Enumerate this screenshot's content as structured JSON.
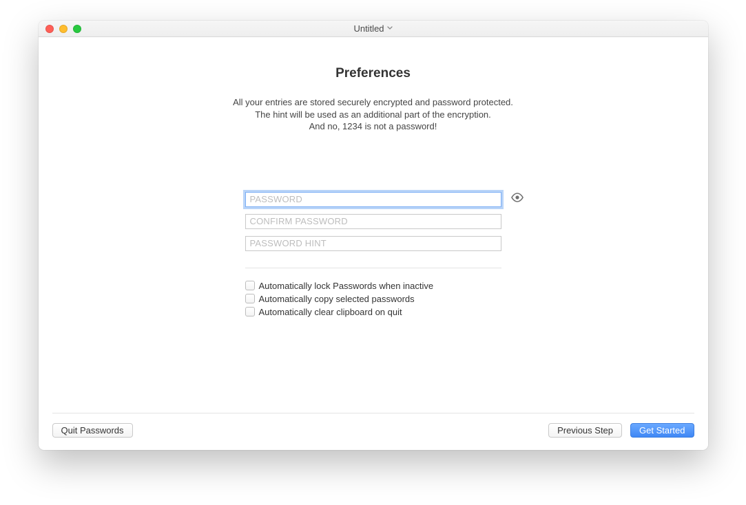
{
  "window": {
    "title": "Untitled"
  },
  "header": {
    "heading": "Preferences",
    "desc_line1": "All your entries are stored securely encrypted and password protected.",
    "desc_line2": "The hint will be used as an additional part of the encryption.",
    "desc_line3": "And no, 1234 is not a password!"
  },
  "form": {
    "password_placeholder": "PASSWORD",
    "confirm_placeholder": "CONFIRM PASSWORD",
    "hint_placeholder": "PASSWORD HINT",
    "password_value": "",
    "confirm_value": "",
    "hint_value": ""
  },
  "checkboxes": {
    "auto_lock": {
      "label": "Automatically lock Passwords when inactive",
      "checked": false
    },
    "auto_copy": {
      "label": "Automatically copy selected passwords",
      "checked": false
    },
    "auto_clear": {
      "label": "Automatically clear clipboard on quit",
      "checked": false
    }
  },
  "footer": {
    "quit_label": "Quit Passwords",
    "prev_label": "Previous Step",
    "start_label": "Get Started"
  }
}
